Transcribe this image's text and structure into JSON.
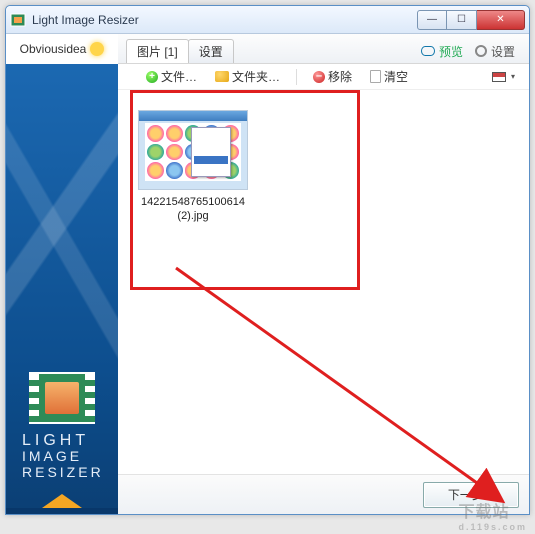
{
  "window": {
    "title": "Light Image Resizer"
  },
  "brand": {
    "company": "Obviousidea",
    "line1": "LIGHT",
    "line2": "IMAGE",
    "line3": "RESIZER"
  },
  "tabs": {
    "images": "图片 [1]",
    "settings": "设置"
  },
  "topbar": {
    "preview": "预览",
    "settings": "设置"
  },
  "toolbar": {
    "addFile": "文件…",
    "addFolder": "文件夹…",
    "remove": "移除",
    "clear": "清空"
  },
  "thumb": {
    "filename": "14221548765100614 (2).jpg"
  },
  "footer": {
    "next": "下一步 >"
  },
  "watermark": {
    "brand": "下载站",
    "url": "d.119s.com"
  }
}
